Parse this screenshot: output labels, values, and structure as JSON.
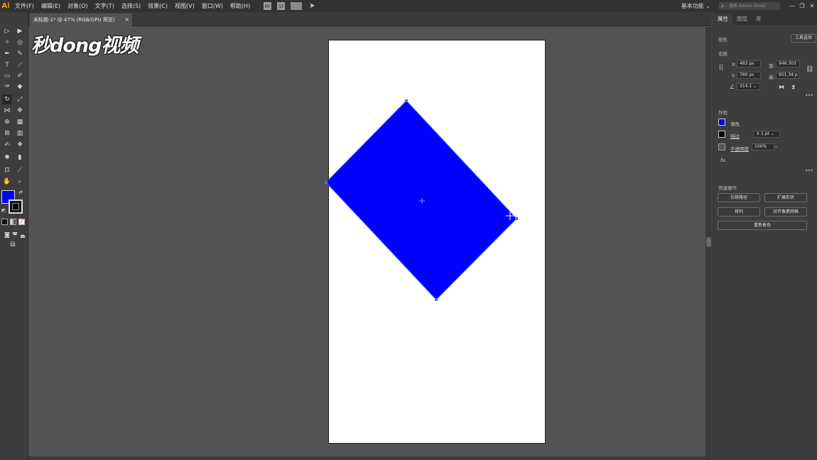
{
  "app": {
    "logo": "Ai"
  },
  "menubar": {
    "items": [
      "文件(F)",
      "编辑(E)",
      "对象(O)",
      "文字(T)",
      "选择(S)",
      "效果(C)",
      "视图(V)",
      "窗口(W)",
      "帮助(H)"
    ],
    "bridge_icon": "Br",
    "stock_icon": "St",
    "workspace": "基本功能",
    "search_placeholder": "搜索 Adobe Stock",
    "win_buttons": [
      "—",
      "❐",
      "✕"
    ]
  },
  "document": {
    "tab_title": "未标题-1* @ 47% (RGB/GPU 预览)",
    "close": "×"
  },
  "watermark": "秒dong视频",
  "colors": {
    "fill": "#0000ff",
    "stroke": "#000000"
  },
  "panel": {
    "tabs": [
      "属性",
      "图层",
      "库"
    ],
    "object_type": "矩形",
    "tool_options_button": "工具选项",
    "transform": {
      "title": "变换",
      "x_label": "X:",
      "x": "463 px",
      "y_label": "Y:",
      "y": "760 px",
      "w_label": "宽:",
      "w": "946.303",
      "h_label": "高:",
      "h": "951.34 p",
      "angle": "314.1"
    },
    "appearance": {
      "title": "外观",
      "fill_label": "填色",
      "stroke_label": "描边",
      "stroke_value": "1 pt",
      "opacity_label": "不透明度",
      "opacity_value": "100%",
      "fx": "fx."
    },
    "quick_actions": {
      "title": "快速操作",
      "buttons": [
        "位移路径",
        "扩展形状",
        "排列",
        "对齐像素网格",
        "重新着色"
      ]
    }
  }
}
